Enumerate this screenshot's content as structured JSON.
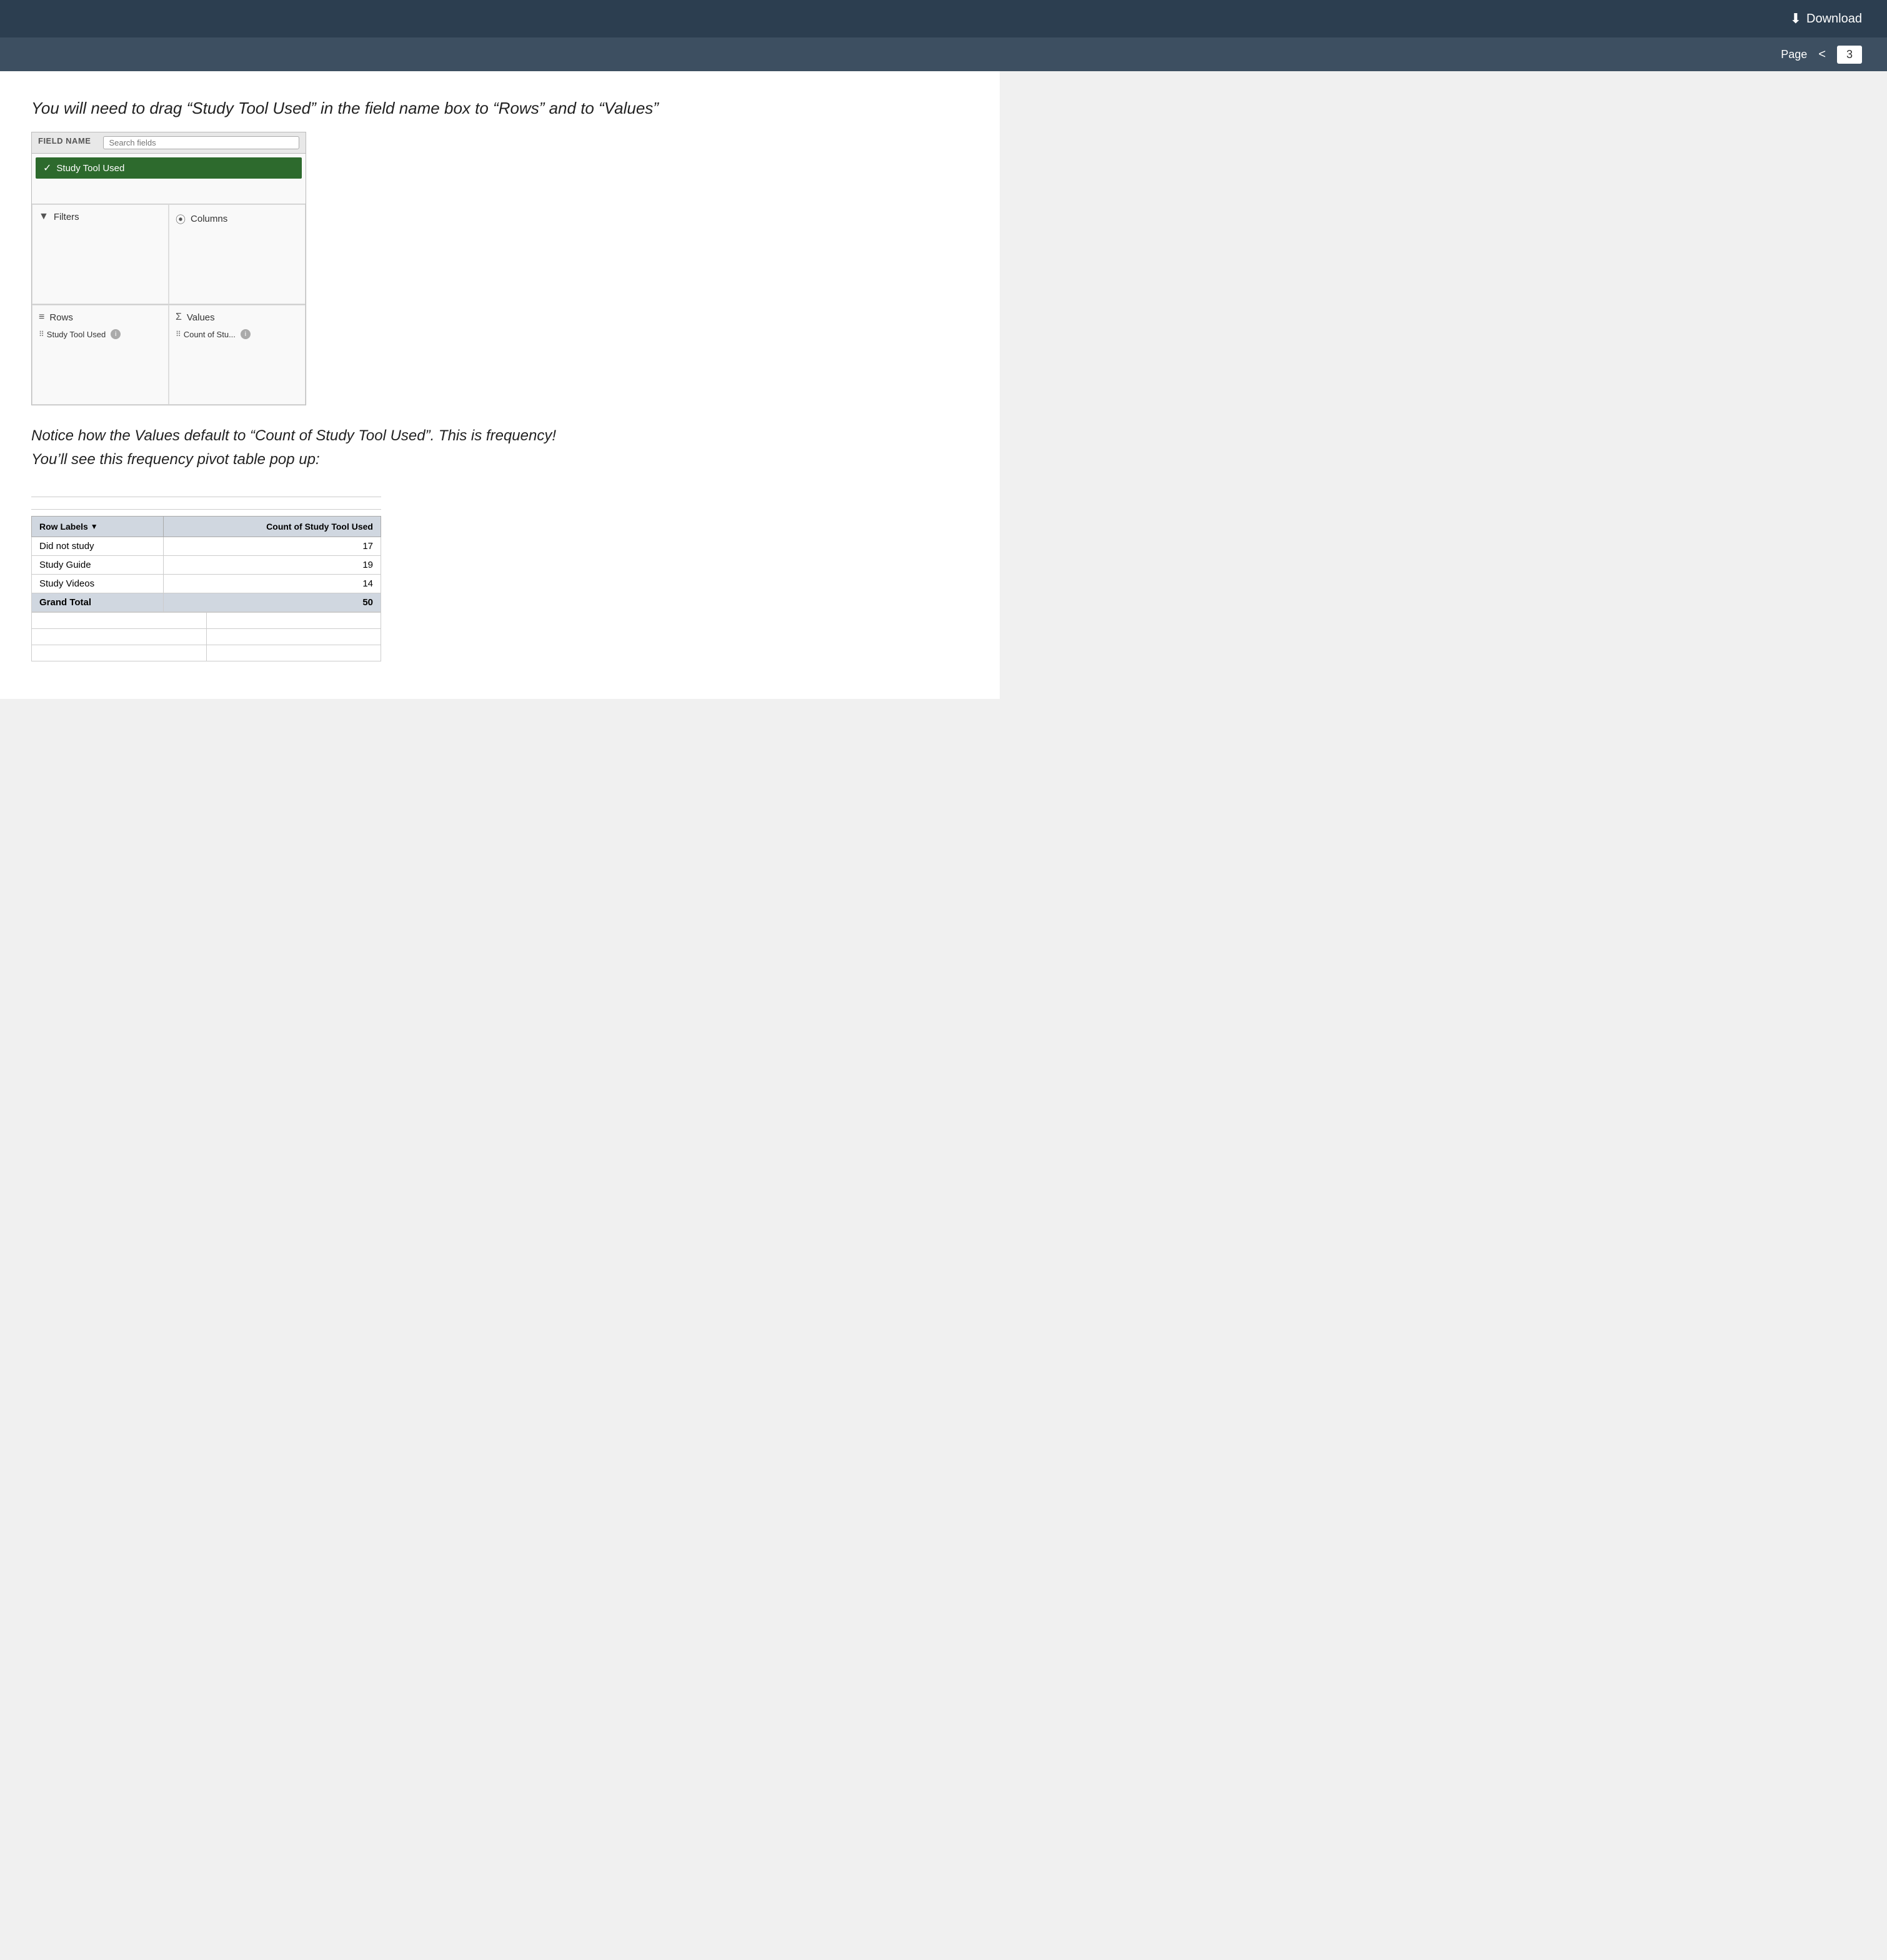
{
  "topbar": {
    "download_label": "Download",
    "download_icon": "⬇"
  },
  "pagenav": {
    "page_label": "Page",
    "prev_icon": "<",
    "page_number": "3"
  },
  "instruction": {
    "text": "You will need to drag “Study Tool Used” in the field name box to “Rows” and to “Values”"
  },
  "pivot_panel": {
    "field_name_label": "FIELD NAME",
    "search_placeholder": "Search fields",
    "field_item": "Study Tool Used",
    "filters_label": "Filters",
    "columns_label": "Columns",
    "rows_label": "Rows",
    "values_label": "Values",
    "rows_item": "Study Tool Used",
    "values_item": "Count of Stu...",
    "filters_icon": "▼",
    "columns_icon": "⦿",
    "rows_icon": "≡",
    "values_icon": "Σ"
  },
  "notice": {
    "line1": "Notice how the Values default to “Count of Study Tool Used”. This is frequency!",
    "line2": "You’ll see this frequency pivot table pop up:"
  },
  "pivot_table": {
    "col1_header": "Row Labels",
    "col2_header": "Count of Study Tool Used",
    "rows": [
      {
        "label": "Did not study",
        "value": "17"
      },
      {
        "label": "Study Guide",
        "value": "19"
      },
      {
        "label": "Study Videos",
        "value": "14"
      },
      {
        "label": "Grand Total",
        "value": "50",
        "is_total": true
      }
    ]
  }
}
